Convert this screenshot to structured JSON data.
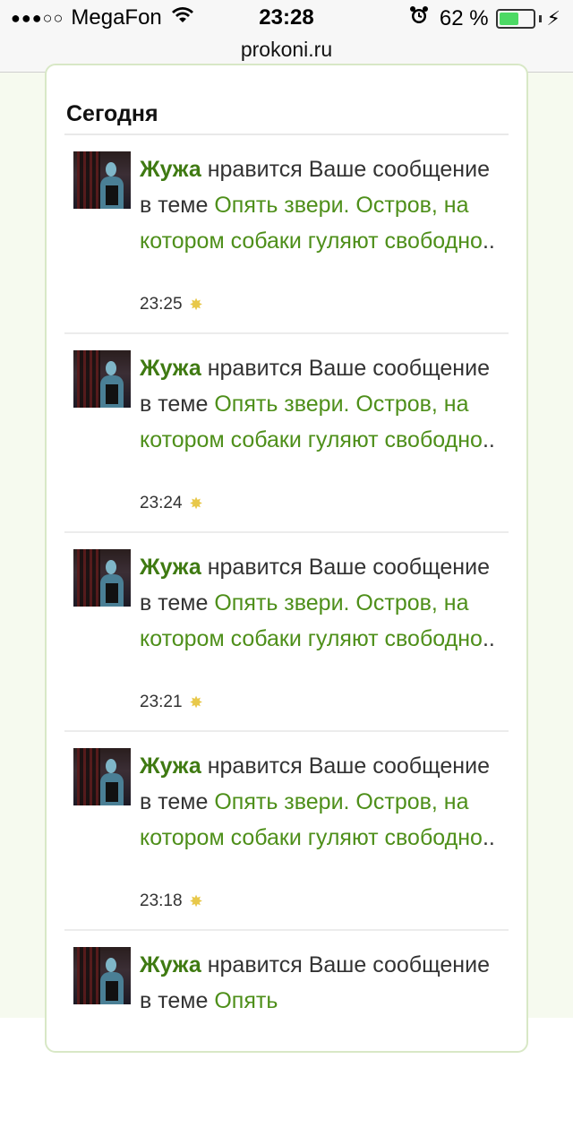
{
  "statusbar": {
    "signal_dots": "●●●○○",
    "carrier": "MegaFon",
    "time": "23:28",
    "battery_percent_label": "62 %",
    "battery_level": 0.62,
    "battery_color": "#4cd964",
    "icons": [
      "wifi-icon",
      "alarm-icon",
      "battery-icon",
      "charging-bolt-icon"
    ]
  },
  "browser": {
    "url": "prokoni.ru"
  },
  "section": {
    "title": "Сегодня"
  },
  "colors": {
    "link_green": "#4e8f1a",
    "user_green": "#3f7a12",
    "page_bg": "#f6faef"
  },
  "notifications": [
    {
      "user": "Жужа",
      "action": "нравится Ваше сообщение в теме",
      "topic": "Опять звери. Остров, на котором собаки гуляют свободно",
      "ellipsis": "..",
      "time": "23:25"
    },
    {
      "user": "Жужа",
      "action": "нравится Ваше сообщение в теме",
      "topic": "Опять звери. Остров, на котором собаки гуляют свободно",
      "ellipsis": "..",
      "time": "23:24"
    },
    {
      "user": "Жужа",
      "action": "нравится Ваше сообщение в теме",
      "topic": "Опять звери. Остров, на котором собаки гуляют свободно",
      "ellipsis": "..",
      "time": "23:21"
    },
    {
      "user": "Жужа",
      "action": "нравится Ваше сообщение в теме",
      "topic": "Опять звери. Остров, на котором собаки гуляют свободно",
      "ellipsis": "..",
      "time": "23:18"
    },
    {
      "user": "Жужа",
      "action": "нравится Ваше сообщение в теме",
      "topic": "Опять",
      "ellipsis": "",
      "time": ""
    }
  ]
}
